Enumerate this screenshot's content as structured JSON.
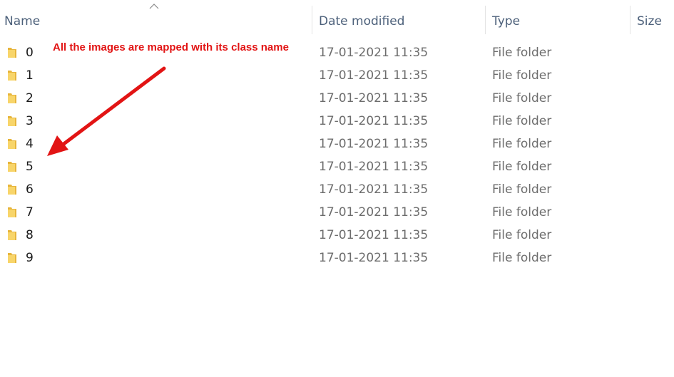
{
  "columns": {
    "name": "Name",
    "date_modified": "Date modified",
    "type": "Type",
    "size": "Size"
  },
  "sort_indicator": "caret-up-icon",
  "annotation": "All the images are mapped with its class name",
  "rows": [
    {
      "name": "0",
      "date": "17-01-2021 11:35",
      "type": "File folder"
    },
    {
      "name": "1",
      "date": "17-01-2021 11:35",
      "type": "File folder"
    },
    {
      "name": "2",
      "date": "17-01-2021 11:35",
      "type": "File folder"
    },
    {
      "name": "3",
      "date": "17-01-2021 11:35",
      "type": "File folder"
    },
    {
      "name": "4",
      "date": "17-01-2021 11:35",
      "type": "File folder"
    },
    {
      "name": "5",
      "date": "17-01-2021 11:35",
      "type": "File folder"
    },
    {
      "name": "6",
      "date": "17-01-2021 11:35",
      "type": "File folder"
    },
    {
      "name": "7",
      "date": "17-01-2021 11:35",
      "type": "File folder"
    },
    {
      "name": "8",
      "date": "17-01-2021 11:35",
      "type": "File folder"
    },
    {
      "name": "9",
      "date": "17-01-2021 11:35",
      "type": "File folder"
    }
  ],
  "colors": {
    "annotation": "#e21414",
    "folder": "#f7c948",
    "header_text": "#4c607a"
  }
}
